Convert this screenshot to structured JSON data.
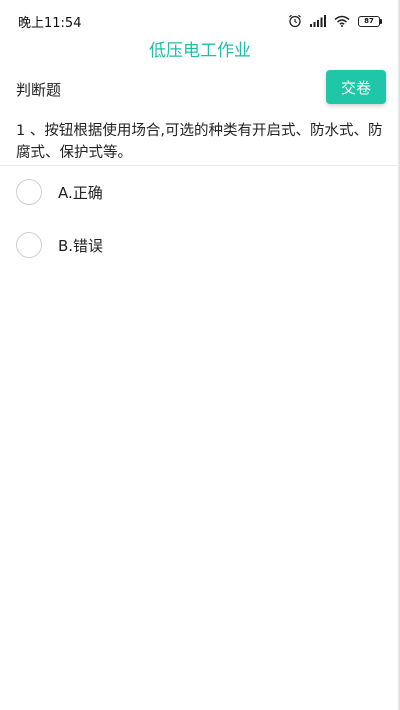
{
  "status_bar": {
    "time": "晚上11:54",
    "battery": "87",
    "battery_level": 0.87,
    "battery_color": "#43c55b"
  },
  "app": {
    "title": "低压电工作业",
    "accent_color": "#1fbfa6"
  },
  "header": {
    "section_label": "判断题",
    "submit_label": "交卷"
  },
  "question": {
    "text": "1 、按钮根据使用场合,可选的种类有开启式、防水式、防腐式、保护式等。"
  },
  "options": [
    {
      "label": "A.正确"
    },
    {
      "label": "B.错误"
    }
  ]
}
